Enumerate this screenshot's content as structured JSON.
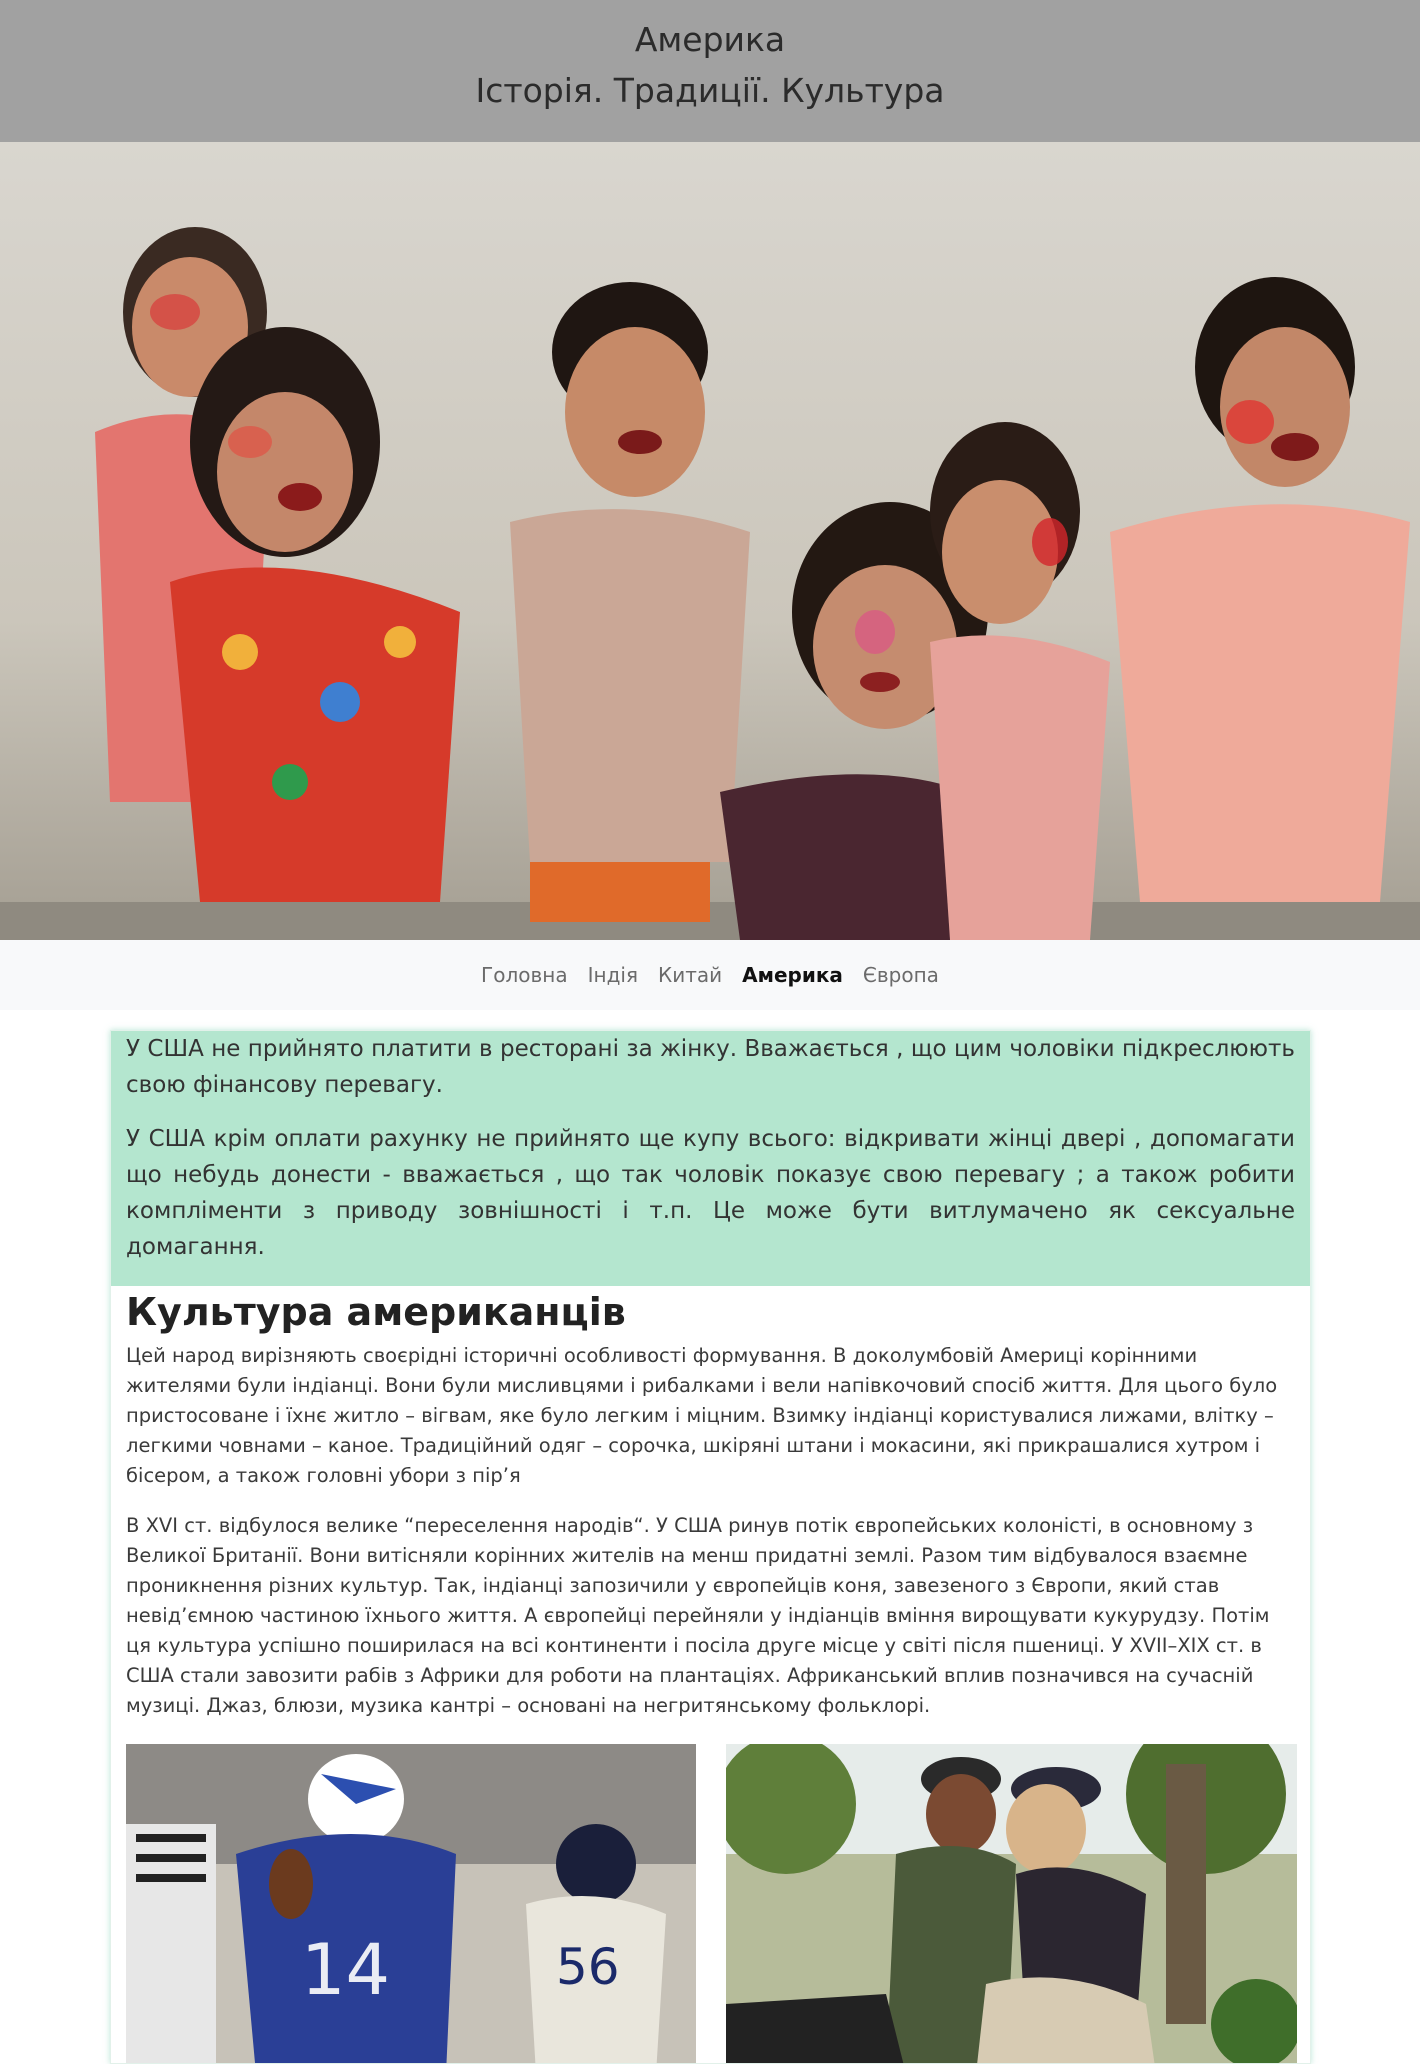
{
  "header": {
    "title_line1": "Америка",
    "title_line2": "Історія. Традиції. Культура"
  },
  "nav": {
    "items": [
      {
        "label": "Головна"
      },
      {
        "label": "Індія"
      },
      {
        "label": "Китай"
      },
      {
        "label": "Америка"
      },
      {
        "label": "Європа"
      }
    ],
    "active_index": 3
  },
  "note": {
    "p1": "У США не прийнято платити в ресторані за жінку. Вважається , що цим чоловіки підкреслюють свою фінансову перевагу.",
    "p2": "У США крім оплати рахунку не прийнято ще купу всього: відкривати жінці двері , допомагати що небудь донести - вважається , що так чоловік показує свою перевагу ; а також робити компліменти з приводу зовнішності і т.п. Це може бути витлумачено як сексуальне домагання."
  },
  "section": {
    "title": "Культура американців",
    "p1": "Цей народ вирізняють своєрідні історичні особливості формування. В доколумбовій Америці корінними жителями були індіанці. Вони були мисливцями і рибалками і вели напівкочовий спосіб життя. Для цього було пристосоване і їхнє житло – вігвам, яке було легким і міцним. Взимку індіанці користувалися лижами, влітку – легкими човнами – каное. Традиційний одяг – сорочка, шкіряні штани і мокасини, які прикрашалися хутром і бісером, а також головні убори з пір’я",
    "p2": "В XVI ст. відбулося велике “переселення народів“. У США ринув потік європейських колоністі, в основному з Великої Британії. Вони витісняли корінних жителів на менш придатні землі. Разом тим відбувалося взаємне проникнення різних культур. Так, індіанці запозичили у європейців коня, завезеного з Європи, який став невід’ємною частиною їхнього життя. А європейці перейняли у індіанців вміння вирощувати кукурудзу. Потім ця культура успішно поширилася на всі континенти і посіла друге місце у світі після пшениці. У XVII–XIX ст. в США стали завозити рабів з Африки для роботи на плантаціях. Африканський вплив позначився на сучасній музиці. Джаз, блюзи, музика кантрі – основані на негритянському фольклорі."
  },
  "images": {
    "hero": "children-holi-photo",
    "left": "american-football-photo",
    "right": "couple-outdoors-photo"
  },
  "colors": {
    "header_bg": "#a1a1a1",
    "nav_bg": "#f8f9fa",
    "note_bg": "#b4e6cf"
  }
}
